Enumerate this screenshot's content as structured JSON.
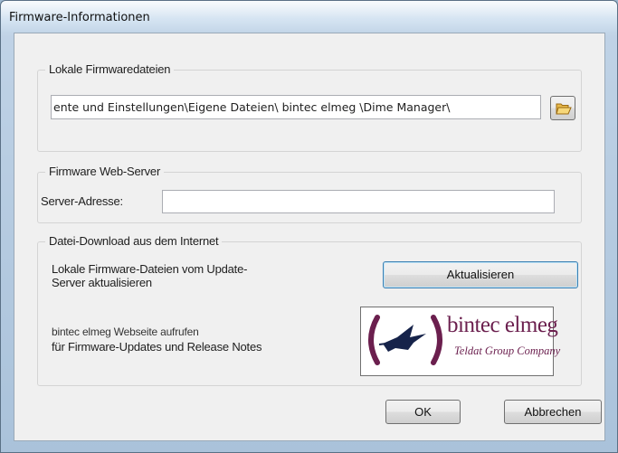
{
  "window": {
    "title": "Firmware-Informationen"
  },
  "local_files": {
    "group_label": "Lokale Firmwaredateien",
    "path_value": "ente und Einstellungen\\Eigene Dateien\\ bintec elmeg \\Dime Manager\\",
    "browse_icon": "open-folder-icon"
  },
  "web_server": {
    "group_label": "Firmware Web-Server",
    "server_label": "Server-Adresse:",
    "server_value": ""
  },
  "download": {
    "group_label": "Datei-Download aus dem Internet",
    "update_text_line1": "Lokale Firmware-Dateien vom Update-",
    "update_text_line2": "Server aktualisieren",
    "update_button": "Aktualisieren",
    "website_text_line1": "bintec elmeg Webseite aufrufen",
    "website_text_line2": "für Firmware-Updates und Release Notes",
    "logo_name": "bintec elmeg",
    "logo_tagline": "Teldat Group Company"
  },
  "footer": {
    "ok_label": "OK",
    "cancel_label": "Abbrechen"
  }
}
